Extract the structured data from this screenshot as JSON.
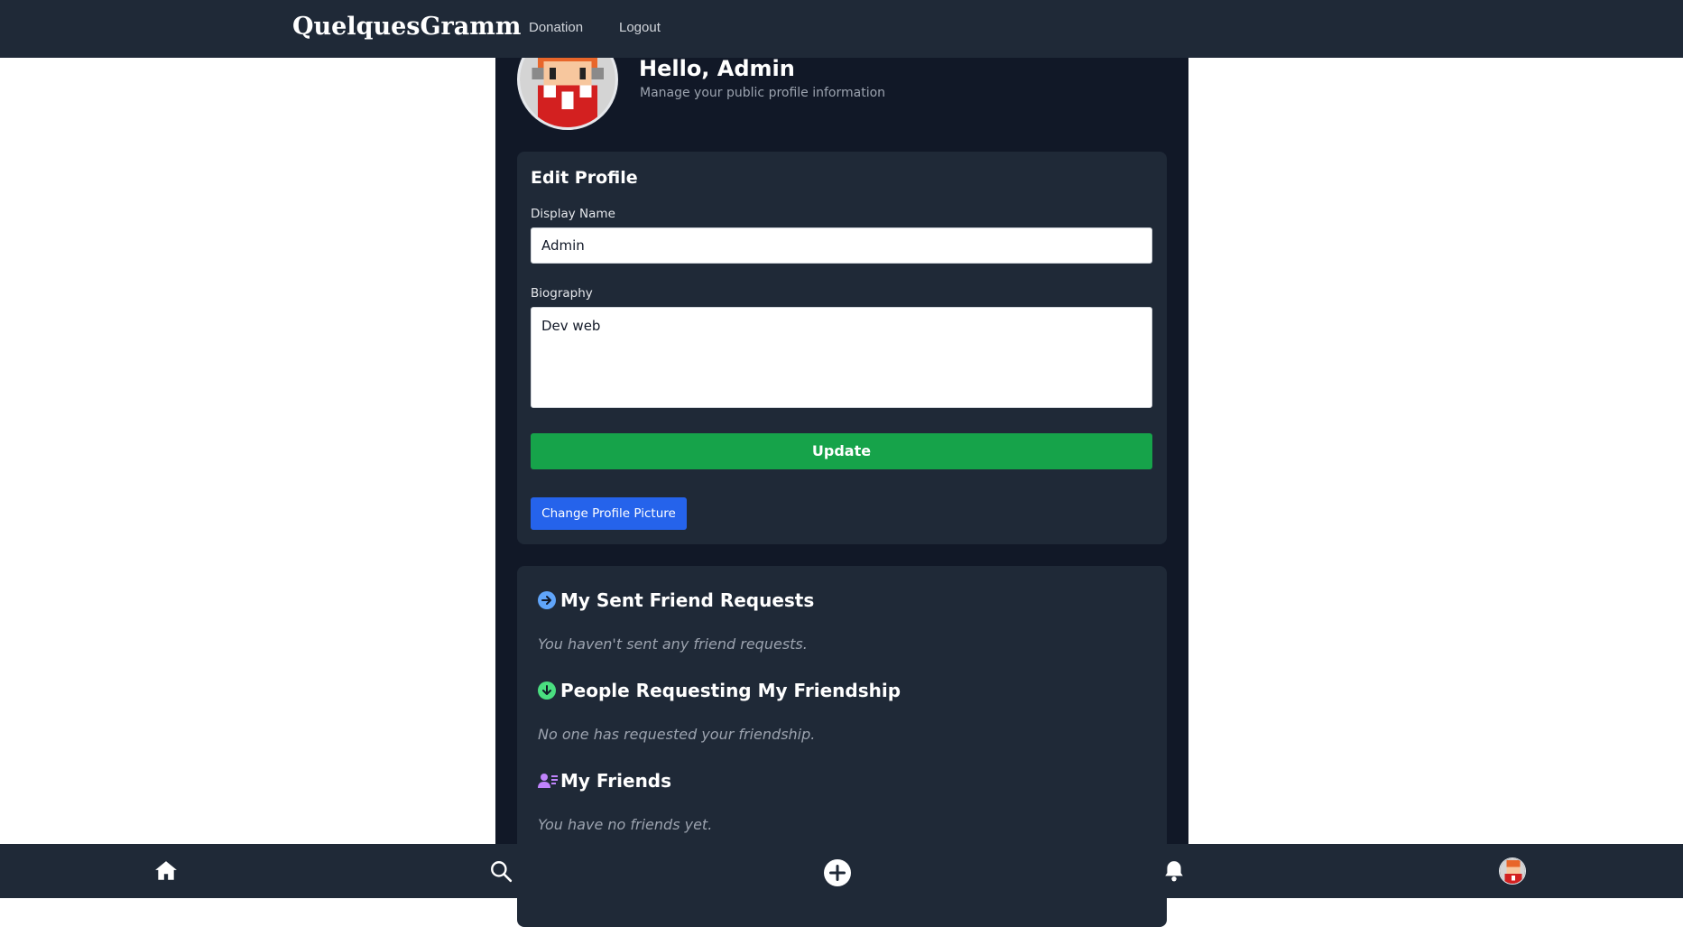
{
  "nav": {
    "brand": "QuelquesGramm",
    "links": [
      "Donation",
      "Logout"
    ]
  },
  "profile": {
    "greeting": "Hello, Admin",
    "subtitle": "Manage your public profile information"
  },
  "edit": {
    "title": "Edit Profile",
    "display_name_label": "Display Name",
    "display_name_value": "Admin",
    "bio_label": "Biography",
    "bio_value": "Dev web",
    "update_label": "Update",
    "change_picture_label": "Change Profile Picture"
  },
  "friends": {
    "sent_title": "My Sent Friend Requests",
    "sent_empty": "You haven't sent any friend requests.",
    "requests_title": "People Requesting My Friendship",
    "requests_empty": "No one has requested your friendship.",
    "friends_title": "My Friends",
    "friends_empty": "You have no friends yet."
  },
  "bottom_nav": {
    "icons": [
      "home-icon",
      "search-icon",
      "plus-circle-icon",
      "bell-icon",
      "avatar"
    ]
  },
  "colors": {
    "nav_bg": "#1f2937",
    "page_bg": "#111827",
    "update_btn": "#16a34a",
    "change_btn": "#2563eb",
    "sent_icon": "#60a5fa",
    "request_icon": "#4ade80",
    "friends_icon": "#c084fc"
  }
}
